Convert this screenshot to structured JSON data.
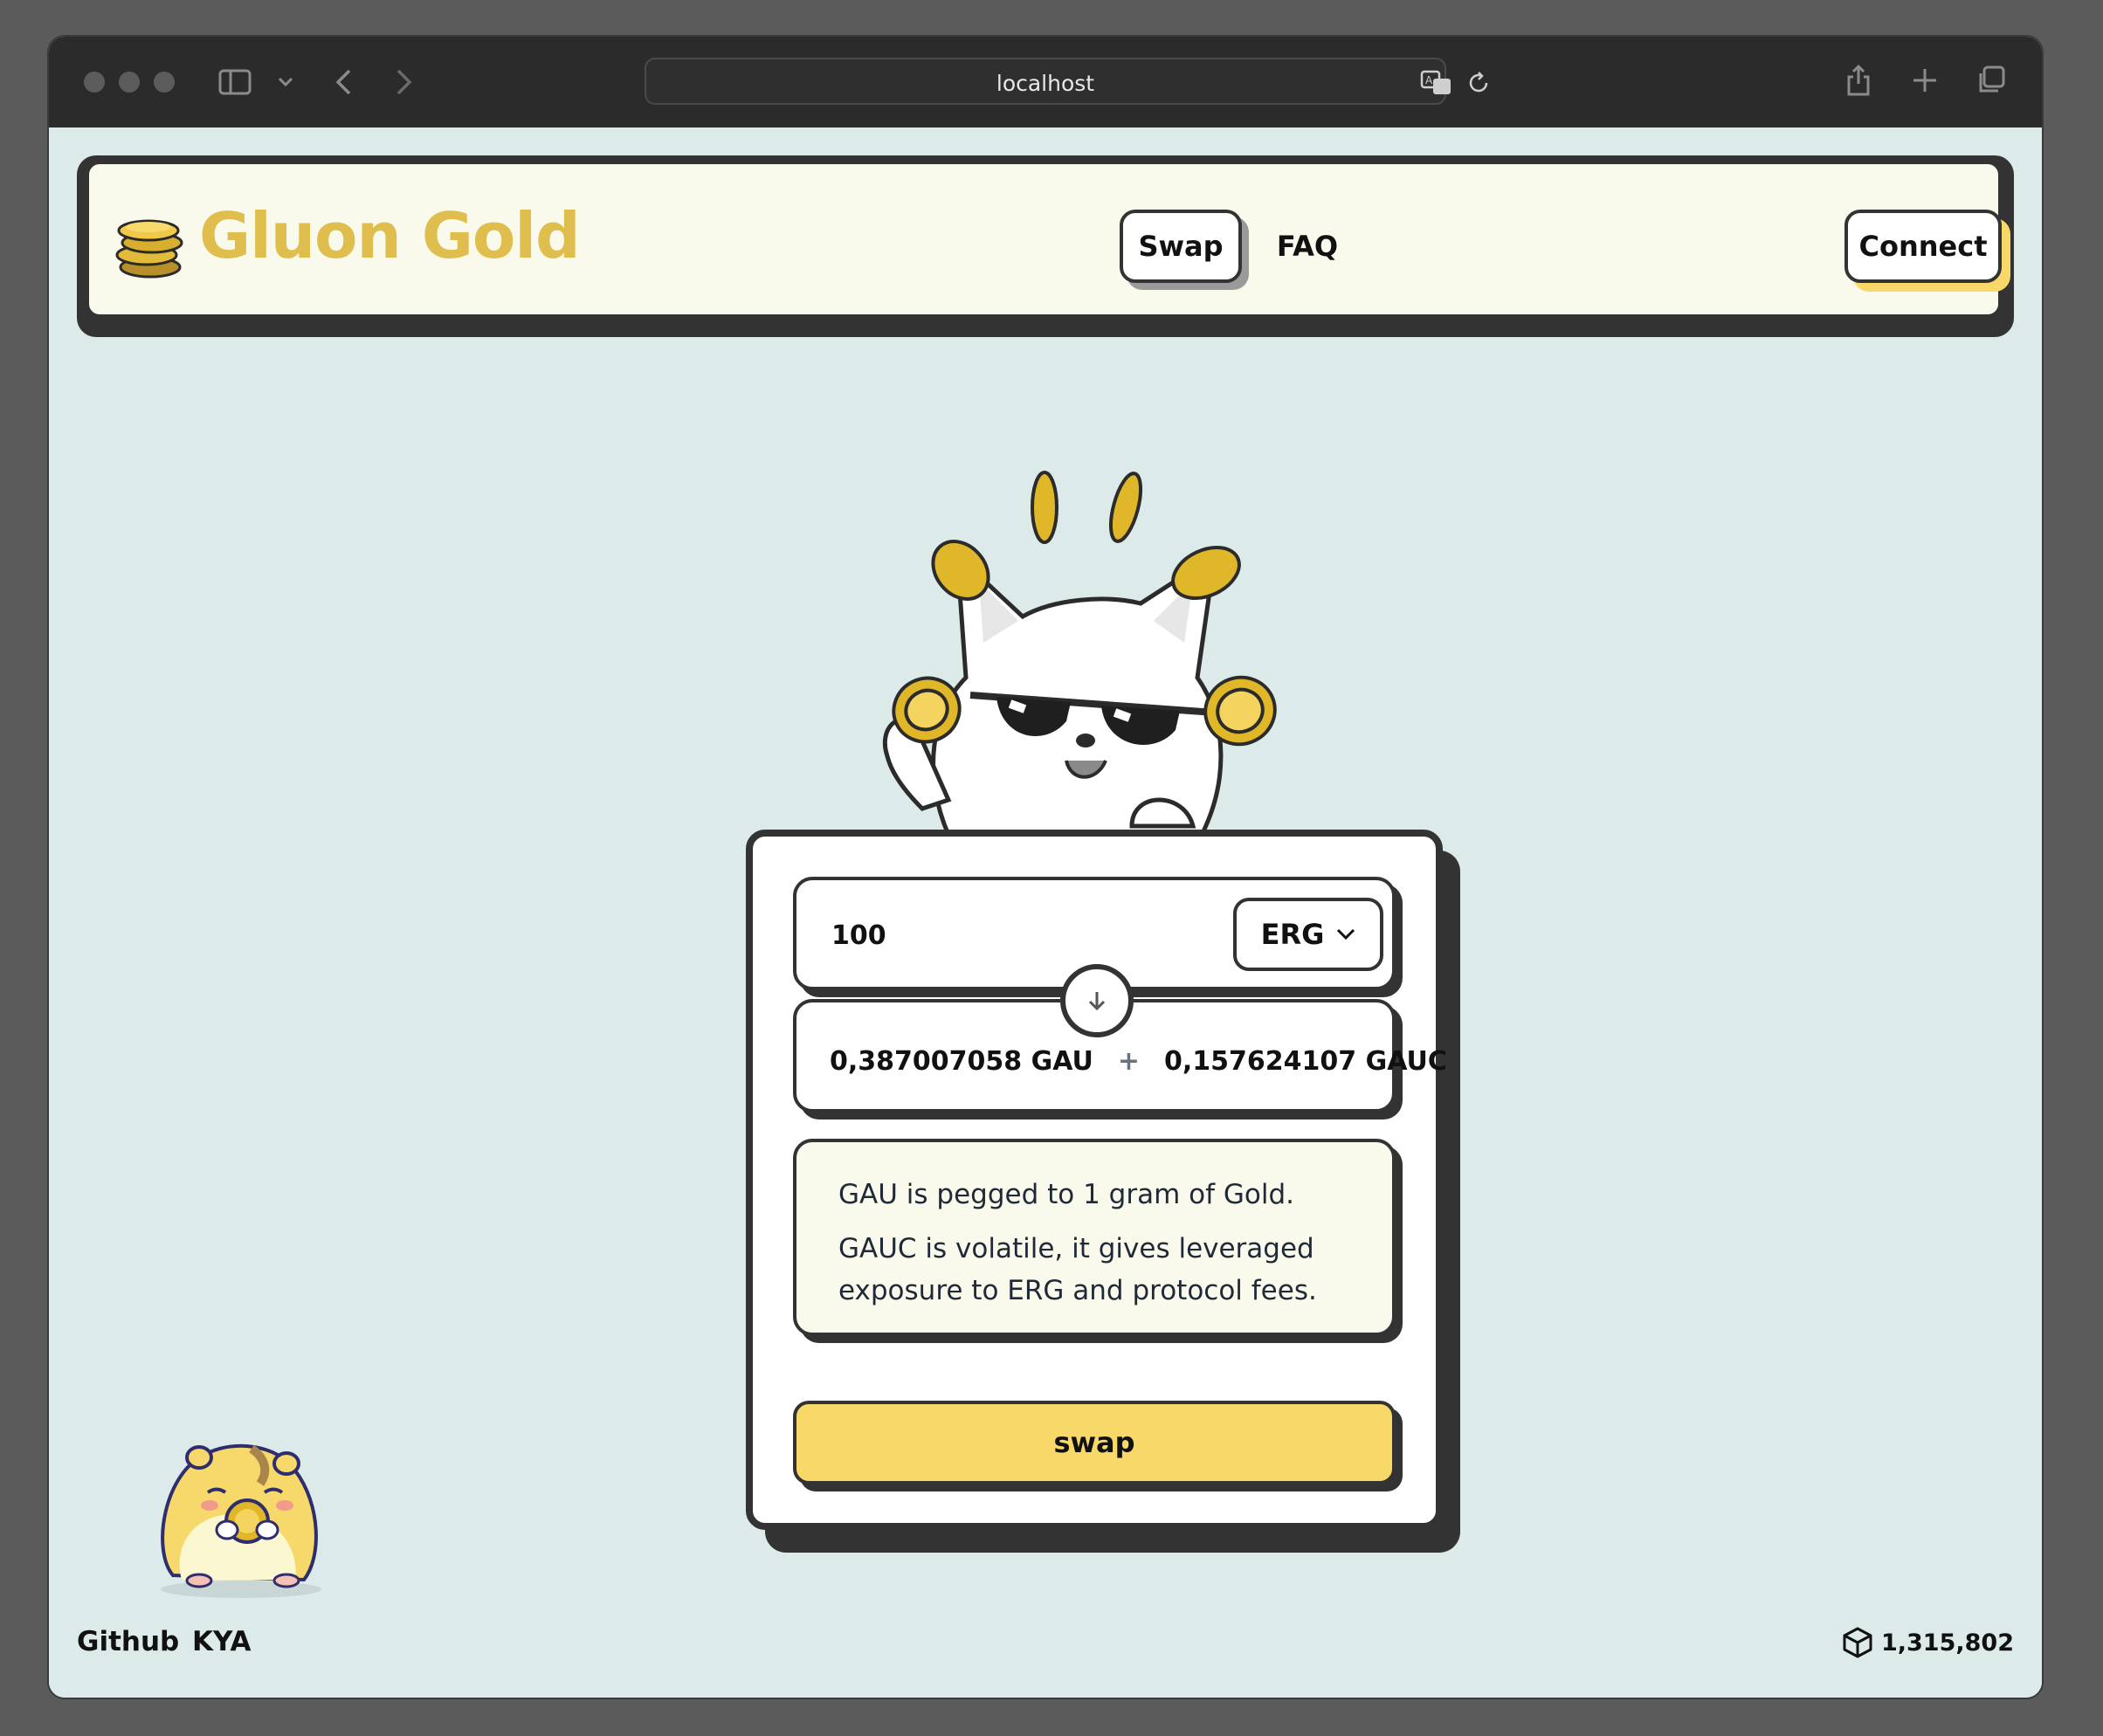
{
  "browser": {
    "url": "localhost"
  },
  "header": {
    "brand": "Gluon Gold",
    "nav": {
      "swap_label": "Swap",
      "faq_label": "FAQ"
    },
    "connect_label": "Connect"
  },
  "swap_card": {
    "input_amount": "100",
    "input_token": "ERG",
    "output": {
      "gau_amount": "0,387007058 GAU",
      "separator": "+",
      "gauc_amount": "0,157624107 GAUC"
    },
    "info": {
      "line1": "GAU is pegged to 1 gram of Gold.",
      "line2": "GAUC is volatile, it gives leveraged exposure to ERG and protocol fees."
    },
    "swap_button_label": "swap"
  },
  "footer": {
    "github_label": "Github",
    "kya_label": "KYA",
    "block_height": "1,315,802"
  },
  "colors": {
    "accent_yellow": "#f8d868",
    "brand_gold": "#e0be4d",
    "page_bg": "#dceae9",
    "panel_bg": "#f9f9ec",
    "border_dark": "#333333"
  }
}
